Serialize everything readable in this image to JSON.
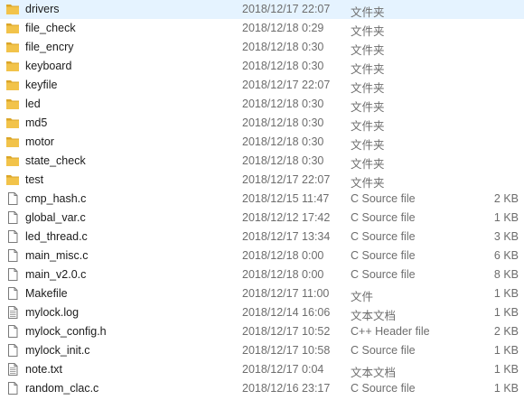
{
  "colors": {
    "folder": "#f2c34a",
    "folder_dark": "#dba628",
    "text": "#1b1b1b",
    "meta_text": "#6d6d6d",
    "file_outline": "#7a7a7a"
  },
  "rows": [
    {
      "name": "drivers",
      "date": "2018/12/17 22:07",
      "type": "文件夹",
      "size": "",
      "icon": "folder-icon"
    },
    {
      "name": "file_check",
      "date": "2018/12/18 0:29",
      "type": "文件夹",
      "size": "",
      "icon": "folder-icon"
    },
    {
      "name": "file_encry",
      "date": "2018/12/18 0:30",
      "type": "文件夹",
      "size": "",
      "icon": "folder-icon"
    },
    {
      "name": "keyboard",
      "date": "2018/12/18 0:30",
      "type": "文件夹",
      "size": "",
      "icon": "folder-icon"
    },
    {
      "name": "keyfile",
      "date": "2018/12/17 22:07",
      "type": "文件夹",
      "size": "",
      "icon": "folder-icon"
    },
    {
      "name": "led",
      "date": "2018/12/18 0:30",
      "type": "文件夹",
      "size": "",
      "icon": "folder-icon"
    },
    {
      "name": "md5",
      "date": "2018/12/18 0:30",
      "type": "文件夹",
      "size": "",
      "icon": "folder-icon"
    },
    {
      "name": "motor",
      "date": "2018/12/18 0:30",
      "type": "文件夹",
      "size": "",
      "icon": "folder-icon"
    },
    {
      "name": "state_check",
      "date": "2018/12/18 0:30",
      "type": "文件夹",
      "size": "",
      "icon": "folder-icon"
    },
    {
      "name": "test",
      "date": "2018/12/17 22:07",
      "type": "文件夹",
      "size": "",
      "icon": "folder-icon"
    },
    {
      "name": "cmp_hash.c",
      "date": "2018/12/15 11:47",
      "type": "C Source file",
      "size": "2 KB",
      "icon": "file-icon"
    },
    {
      "name": "global_var.c",
      "date": "2018/12/12 17:42",
      "type": "C Source file",
      "size": "1 KB",
      "icon": "file-icon"
    },
    {
      "name": "led_thread.c",
      "date": "2018/12/17 13:34",
      "type": "C Source file",
      "size": "3 KB",
      "icon": "file-icon"
    },
    {
      "name": "main_misc.c",
      "date": "2018/12/18 0:00",
      "type": "C Source file",
      "size": "6 KB",
      "icon": "file-icon"
    },
    {
      "name": "main_v2.0.c",
      "date": "2018/12/18 0:00",
      "type": "C Source file",
      "size": "8 KB",
      "icon": "file-icon"
    },
    {
      "name": "Makefile",
      "date": "2018/12/17 11:00",
      "type": "文件",
      "size": "1 KB",
      "icon": "file-icon"
    },
    {
      "name": "mylock.log",
      "date": "2018/12/14 16:06",
      "type": "文本文档",
      "size": "1 KB",
      "icon": "text-document-icon"
    },
    {
      "name": "mylock_config.h",
      "date": "2018/12/17 10:52",
      "type": "C++ Header file",
      "size": "2 KB",
      "icon": "file-icon"
    },
    {
      "name": "mylock_init.c",
      "date": "2018/12/17 10:58",
      "type": "C Source file",
      "size": "1 KB",
      "icon": "file-icon"
    },
    {
      "name": "note.txt",
      "date": "2018/12/17 0:04",
      "type": "文本文档",
      "size": "1 KB",
      "icon": "text-document-icon"
    },
    {
      "name": "random_clac.c",
      "date": "2018/12/16 23:17",
      "type": "C Source file",
      "size": "1 KB",
      "icon": "file-icon"
    }
  ]
}
